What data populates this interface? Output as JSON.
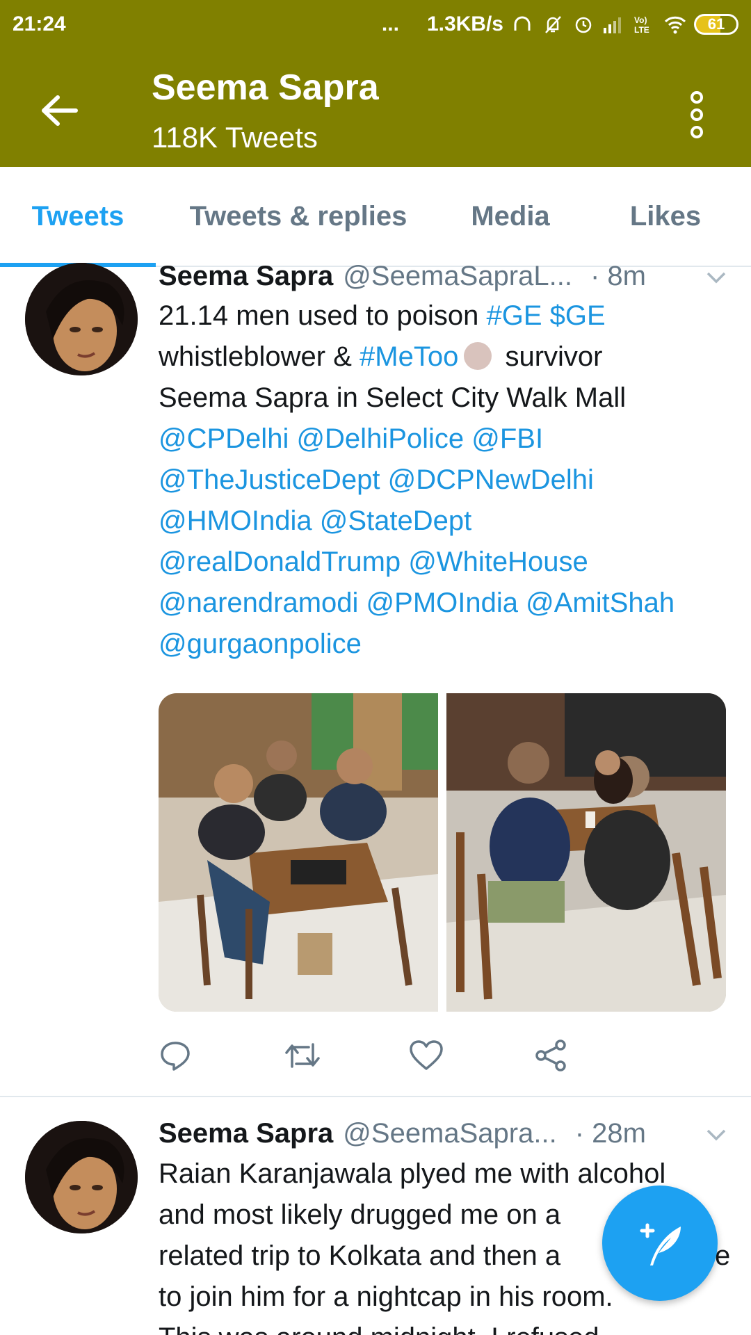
{
  "status_bar": {
    "time": "21:24",
    "dots": "...",
    "network_speed": "1.3KB/s",
    "battery": "61",
    "icons": [
      "headphones-icon",
      "bell-off-icon",
      "alarm-icon",
      "signal-icon",
      "volte-icon",
      "wifi-icon",
      "battery-icon"
    ]
  },
  "header": {
    "title": "Seema Sapra",
    "subtitle": "118K Tweets",
    "back_icon": "arrow-left-icon",
    "more_icon": "more-vertical-icon",
    "color": "#808000"
  },
  "tabs": [
    {
      "label": "Tweets",
      "active": true
    },
    {
      "label": "Tweets & replies",
      "active": false
    },
    {
      "label": "Media",
      "active": false
    },
    {
      "label": "Likes",
      "active": false
    }
  ],
  "tweets": [
    {
      "name": "Seema Sapra",
      "handle": "@SeemaSapraL...",
      "time": "· 8m",
      "text": {
        "l1a": "21.14 men used to poison ",
        "l1b": "#GE $GE",
        "l2a": "whistleblower & ",
        "l2b": "#MeToo",
        "l2c": " survivor",
        "l3": "Seema Sapra in Select City Walk Mall",
        "l4": "@CPDelhi @DelhiPolice @FBI",
        "l5": "@TheJusticeDept @DCPNewDelhi",
        "l6": "@HMOIndia @StateDept",
        "l7": "@realDonaldTrump @WhiteHouse",
        "l8": "@narendramodi @PMOIndia @AmitShah",
        "l9": "@gurgaonpolice"
      },
      "actions": [
        "reply-icon",
        "retweet-icon",
        "like-icon",
        "share-icon"
      ]
    },
    {
      "name": "Seema Sapra",
      "handle": "@SeemaSapra...",
      "time": "· 28m",
      "text": {
        "l1": "Raian Karanjawala plyed me with alcohol",
        "l2": "and most likely drugged me on a",
        "l3": "related trip to Kolkata and then a",
        "l3b": "e",
        "l4": "to join him for a nightcap in his room.",
        "l5": "This was around midnight. I refused"
      }
    }
  ],
  "colors": {
    "accent": "#1da1f2",
    "link": "#1b95e0",
    "muted": "#657786"
  }
}
